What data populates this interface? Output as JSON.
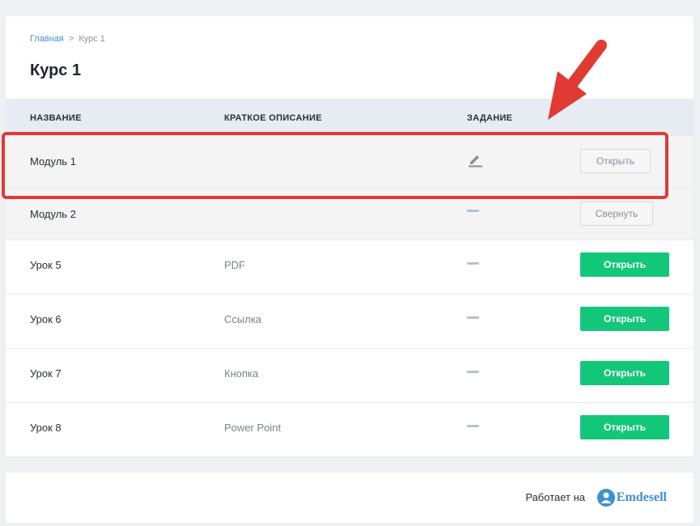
{
  "breadcrumb": {
    "home": "Главная",
    "separator": ">",
    "current": "Курс 1"
  },
  "page": {
    "title": "Курс 1"
  },
  "table": {
    "headers": {
      "name": "НАЗВАНИЕ",
      "description": "КРАТКОЕ ОПИСАНИЕ",
      "task": "ЗАДАНИЕ"
    },
    "rows": [
      {
        "name": "Модуль 1",
        "description": "",
        "task_icon": "pencil-icon",
        "action": "Открыть"
      },
      {
        "name": "Модуль 2",
        "description": "",
        "task_icon": "dash-icon",
        "action": "Свернуть"
      },
      {
        "name": "Урок 5",
        "description": "PDF",
        "task_icon": "dash-icon",
        "action": "Открыть"
      },
      {
        "name": "Урок 6",
        "description": "Ссылка",
        "task_icon": "dash-icon",
        "action": "Открыть"
      },
      {
        "name": "Урок 7",
        "description": "Кнопка",
        "task_icon": "dash-icon",
        "action": "Открыть"
      },
      {
        "name": "Урок 8",
        "description": "Power Point",
        "task_icon": "dash-icon",
        "action": "Открыть"
      }
    ]
  },
  "footer": {
    "powered_by": "Работает на",
    "brand": "Emdesell"
  },
  "annotation": {
    "highlight_color": "#e03a33",
    "icon": "red-arrow-icon"
  },
  "colors": {
    "accent_green": "#13c77a",
    "link_blue": "#3e8fd0",
    "header_bg": "#e7ebf2"
  }
}
